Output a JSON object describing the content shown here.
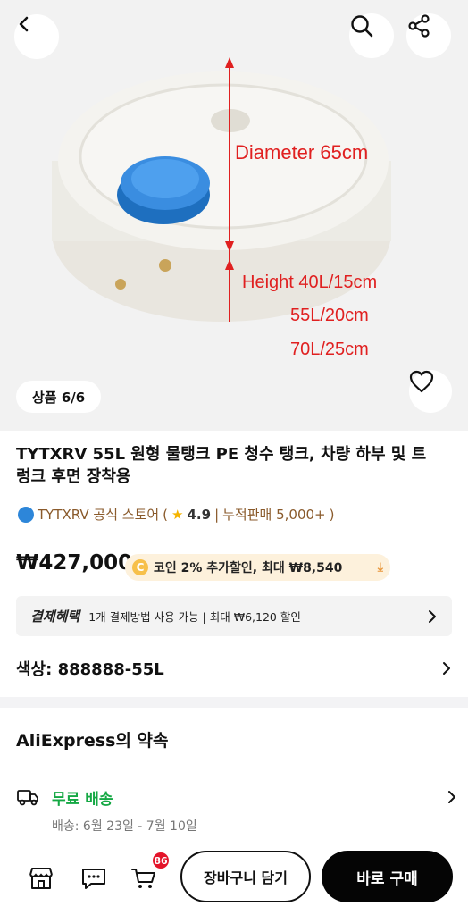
{
  "hero": {
    "counter": "상품 6/6",
    "labels": {
      "diameter": "Diameter 65cm",
      "height_40": "Height 40L/15cm",
      "height_55": "55L/20cm",
      "height_70": "70L/25cm"
    }
  },
  "product": {
    "title": "TYTXRV 55L 원형 물탱크 PE 청수 탱크, 차량 하부 및 트렁크 후면 장착용",
    "store_name": "TYTXRV 공식 스토어",
    "rating": "4.9",
    "sales": "누적판매 5,000+",
    "price": "₩427,000",
    "coin_offer": "코인 2% 추가할인, 최대 ₩8,540"
  },
  "benefit": {
    "tag": "결제혜택",
    "text": "1개 결제방법 사용 가능 | 최대 ₩6,120 할인"
  },
  "option": {
    "label": "색상: 888888-55L"
  },
  "promise": {
    "title": "AliExpress의 약속",
    "shipping_label": "무료 배송",
    "shipping_date": "배송: 6월 23일 - 7월 10일"
  },
  "bottom_bar": {
    "cart_count": "86",
    "add_to_cart": "장바구니 담기",
    "buy_now": "바로 구매"
  },
  "colors": {
    "price_text": "#111111",
    "store_text": "#8a5a2b",
    "shipping_green": "#15a844",
    "badge_red": "#e4142a",
    "coin_pill_bg": "#fdf1dc",
    "label_red": "#e02020"
  },
  "icons": [
    "back-icon",
    "search-icon",
    "share-icon",
    "heart-icon",
    "store-icon",
    "chat-icon",
    "cart-icon",
    "truck-icon",
    "chevron-right-icon",
    "coin-icon",
    "download-icon",
    "star-icon"
  ]
}
